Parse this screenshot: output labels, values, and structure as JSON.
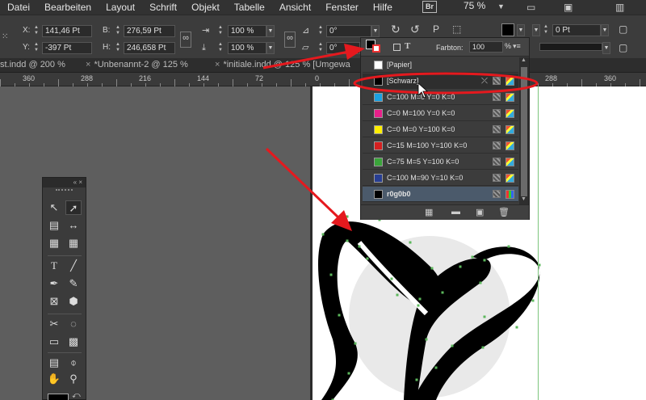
{
  "menu": {
    "items": [
      "Datei",
      "Bearbeiten",
      "Layout",
      "Schrift",
      "Objekt",
      "Tabelle",
      "Ansicht",
      "Fenster",
      "Hilfe"
    ],
    "bridge_label": "Br",
    "zoom": "75 %"
  },
  "control": {
    "x_label": "X:",
    "x_value": "141,46 Pt",
    "y_label": "Y:",
    "y_value": "-397 Pt",
    "b_label": "B:",
    "b_value": "276,59 Pt",
    "h_label": "H:",
    "h_value": "246,658 Pt",
    "scale_x": "100 %",
    "scale_y": "100 %",
    "angle": "0°",
    "shear": "0°",
    "stroke_weight": "0 Pt",
    "tint_label": "Farbton:",
    "tint_value": "100",
    "tint_unit": "%"
  },
  "tabs": [
    "st.indd @ 200 %",
    "*Unbenannt-2 @ 125 %",
    "*initiale.indd @ 125 % [Umgewa"
  ],
  "ruler": {
    "labels": [
      "360",
      "288",
      "216",
      "144",
      "72",
      "0",
      "288",
      "360"
    ]
  },
  "swatches": {
    "items": [
      {
        "name": "[Papier]",
        "color": "#ffffff"
      },
      {
        "name": "[Schwarz]",
        "color": "#000000"
      },
      {
        "name": "C=100 M=0 Y=0 K=0",
        "color": "#1ba1e2"
      },
      {
        "name": "C=0 M=100 Y=0 K=0",
        "color": "#e8208a"
      },
      {
        "name": "C=0 M=0 Y=100 K=0",
        "color": "#ffee00"
      },
      {
        "name": "C=15 M=100 Y=100 K=0",
        "color": "#d42020"
      },
      {
        "name": "C=75 M=5 Y=100 K=0",
        "color": "#3aa43a"
      },
      {
        "name": "C=100 M=90 Y=10 K=0",
        "color": "#283e92"
      },
      {
        "name": "r0g0b0",
        "color": "#000000"
      }
    ]
  },
  "tools": {
    "header_label": "«"
  },
  "colors": {
    "annotation_red": "#e5191e",
    "page": "#ffffff",
    "pasteboard": "#5e5e5e",
    "anchor_green": "#5cb85c"
  }
}
